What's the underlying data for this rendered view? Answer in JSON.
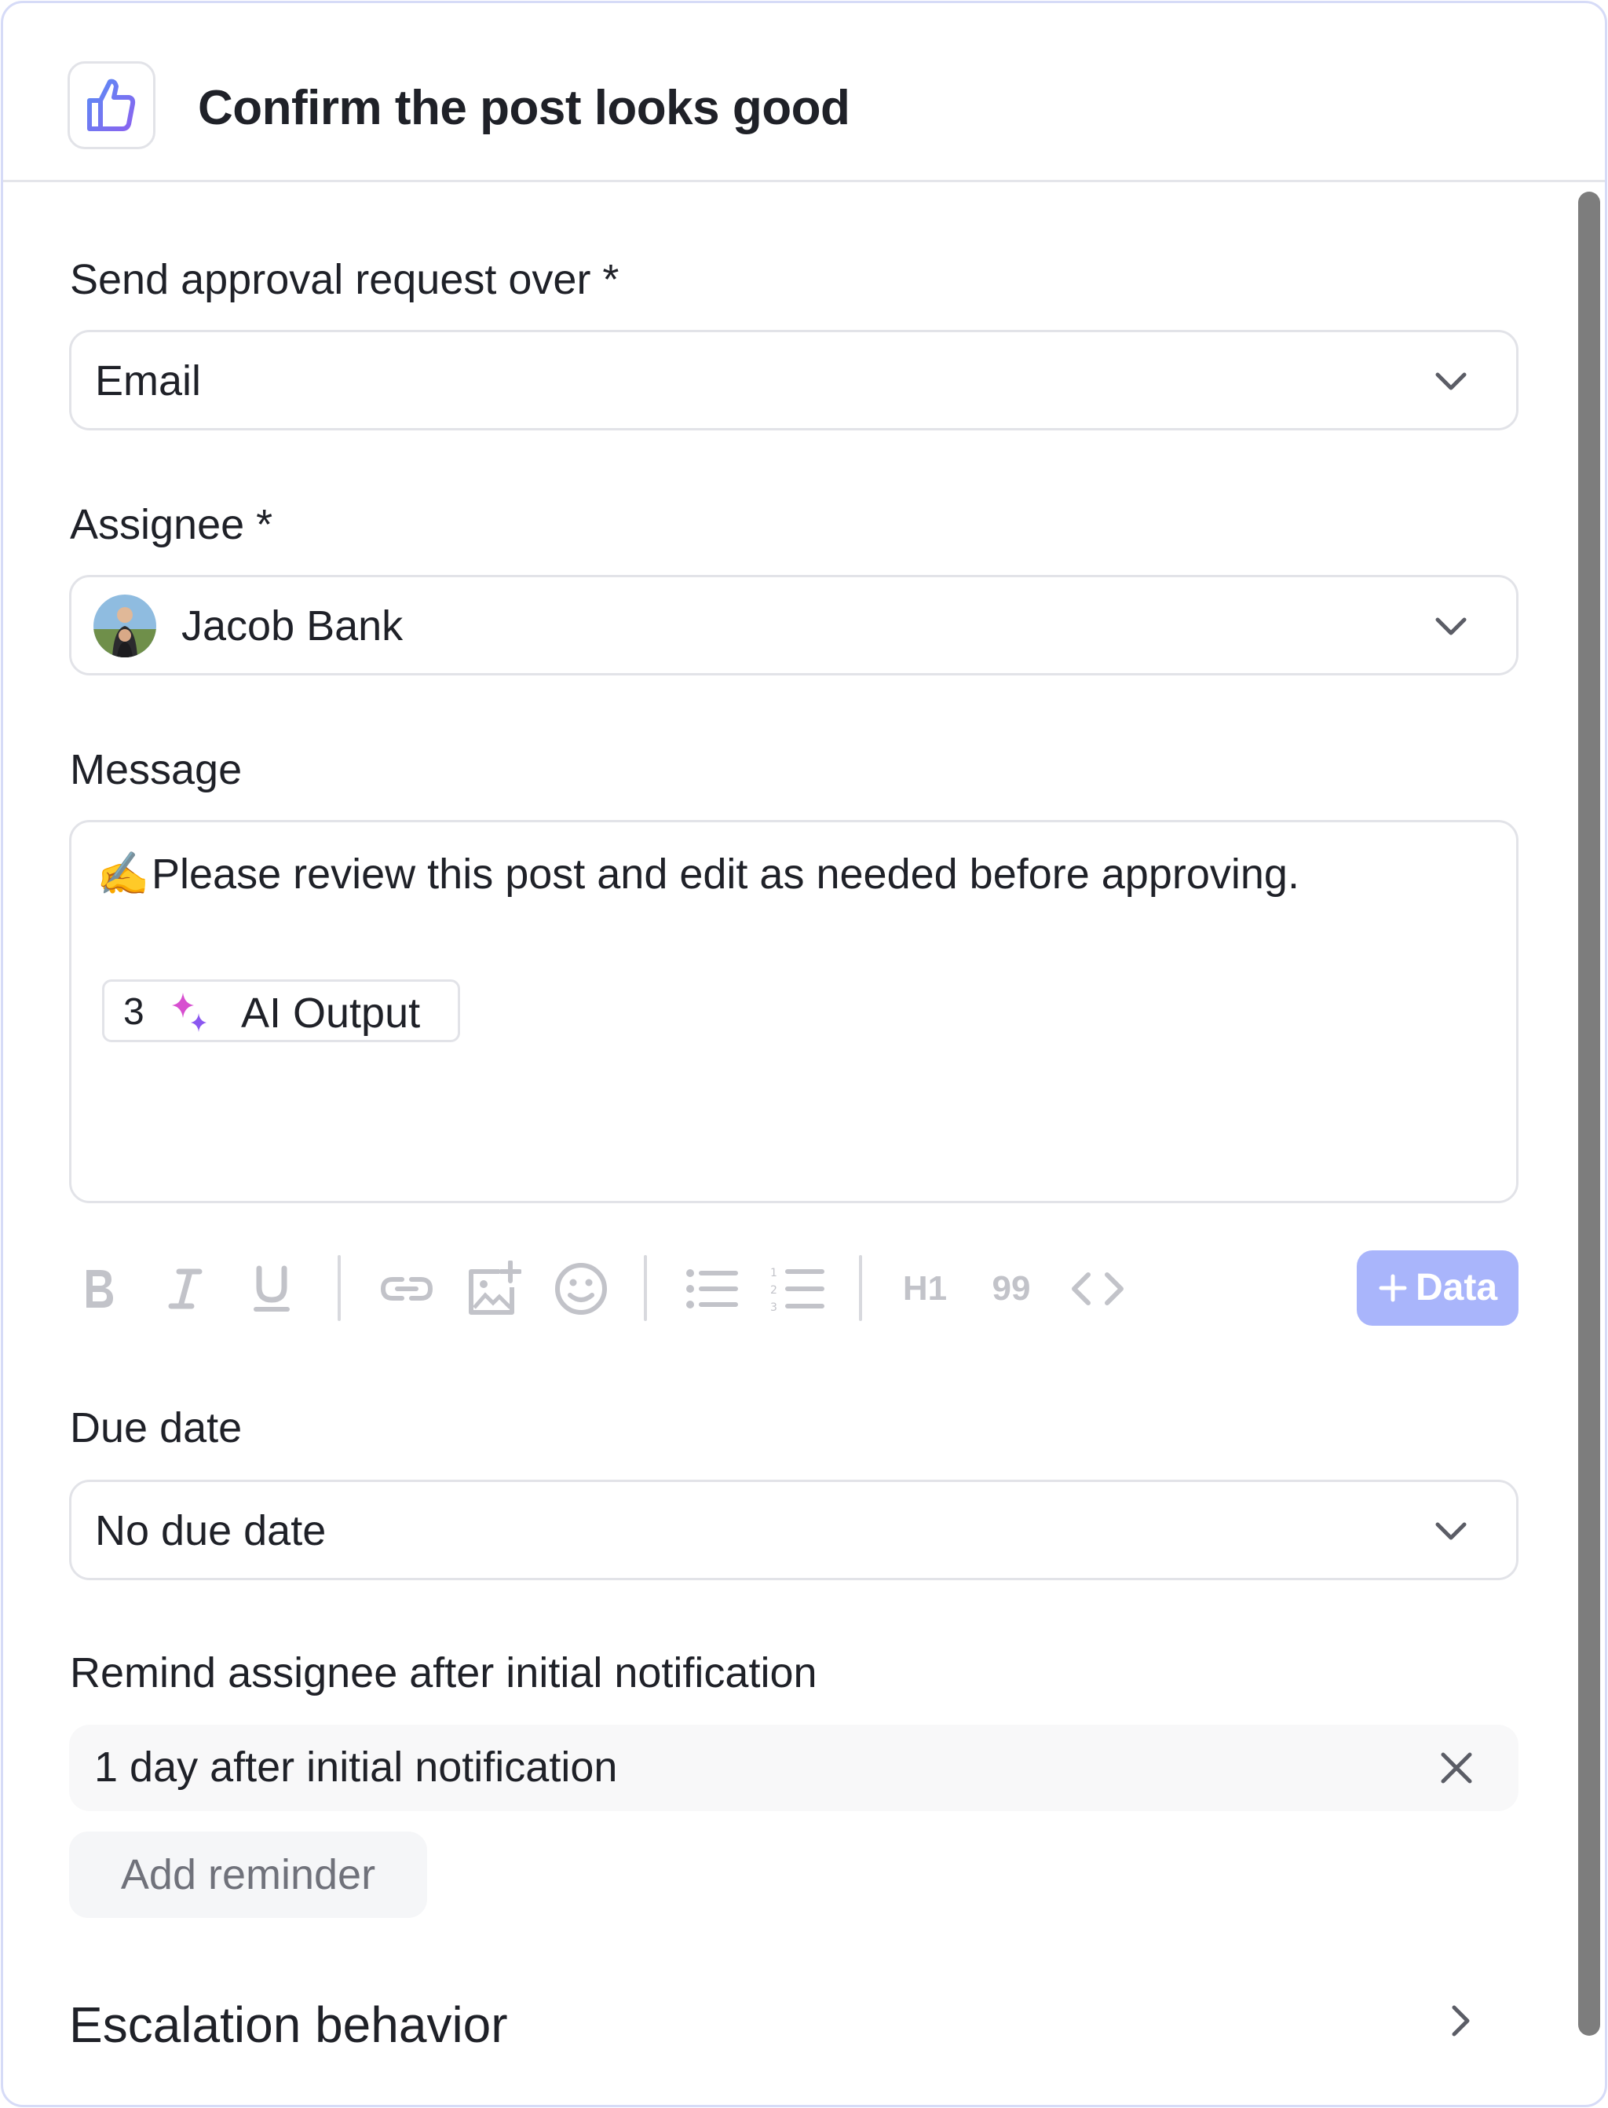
{
  "header": {
    "title": "Confirm the post looks good",
    "icon": "thumbs-up-icon"
  },
  "form": {
    "channel": {
      "label": "Send approval request over *",
      "value": "Email"
    },
    "assignee": {
      "label": "Assignee *",
      "value": "Jacob Bank"
    },
    "message": {
      "label": "Message",
      "emoji": "✍️",
      "text": "Please review this post and edit as needed before approving.",
      "chip": {
        "number": "3",
        "label": "AI Output",
        "icon": "sparkles-icon"
      }
    },
    "toolbar": {
      "icons": [
        "bold-icon",
        "italic-icon",
        "underline-icon",
        "link-icon",
        "image-add-icon",
        "emoji-icon",
        "bullet-list-icon",
        "numbered-list-icon",
        "heading-icon",
        "quote-icon",
        "code-icon"
      ],
      "heading_label": "H1",
      "quote_label": "99",
      "data_button": "Data"
    },
    "due_date": {
      "label": "Due date",
      "value": "No due date"
    },
    "reminder": {
      "label": "Remind assignee after initial notification",
      "items": [
        "1 day after initial notification"
      ],
      "add_label": "Add reminder"
    },
    "escalation": {
      "title": "Escalation behavior"
    }
  },
  "colors": {
    "accent": "#6f7ff5",
    "data_button_bg": "#a9b5fb",
    "border": "#e2e3e8",
    "panel_border": "#d6dbf7",
    "text": "#1f2128",
    "muted_icon": "#c2c3c9",
    "scrollbar": "#7d7d7d"
  }
}
